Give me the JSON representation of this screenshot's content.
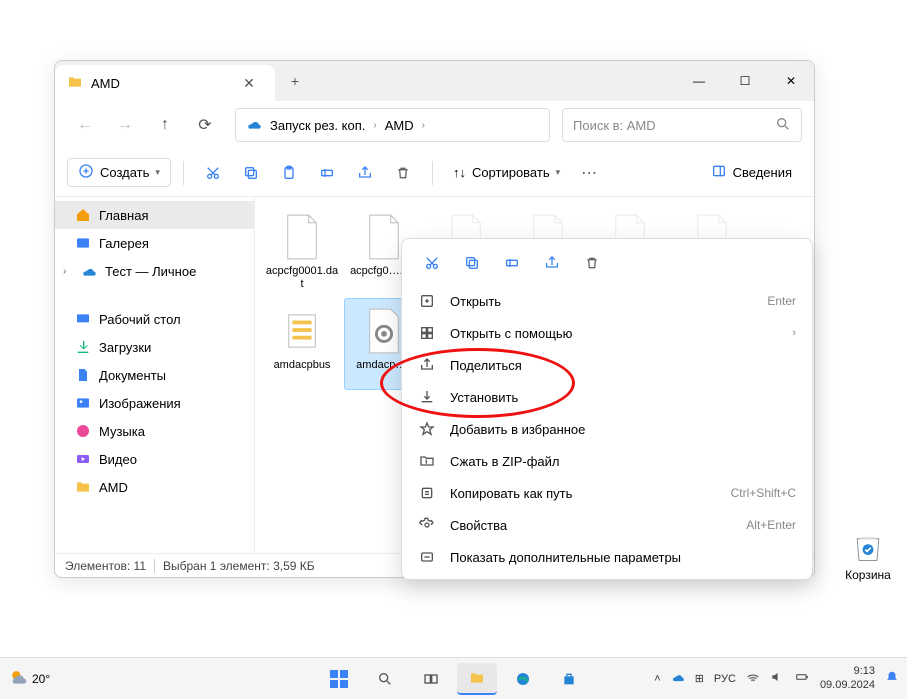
{
  "window": {
    "tab_title": "AMD",
    "breadcrumb": {
      "root": "Запуск рез. коп.",
      "folder": "AMD"
    },
    "search_placeholder": "Поиск в: AMD",
    "toolbar": {
      "create": "Создать",
      "sort": "Сортировать",
      "details": "Сведения"
    },
    "sidebar": {
      "home": "Главная",
      "gallery": "Галерея",
      "personal": "Тест — Личное",
      "desktop": "Рабочий стол",
      "downloads": "Загрузки",
      "documents": "Документы",
      "pictures": "Изображения",
      "music": "Музыка",
      "videos": "Видео",
      "amd": "AMD"
    },
    "files": [
      {
        "name": "acpcfg0001.dat",
        "type": "dat"
      },
      {
        "name": "acpcfg0….dat",
        "type": "dat"
      },
      {
        "name": "",
        "type": "dat"
      },
      {
        "name": "",
        "type": "dat"
      },
      {
        "name": "",
        "type": "dat"
      },
      {
        "name": "",
        "type": "dat"
      },
      {
        "name": "amdacpbus",
        "type": "inf-b"
      },
      {
        "name": "amdacp…s",
        "type": "inf",
        "selected": true
      }
    ],
    "status": {
      "count": "Элементов: 11",
      "selected": "Выбран 1 элемент: 3,59 КБ"
    }
  },
  "context_menu": {
    "open": {
      "label": "Открыть",
      "shortcut": "Enter"
    },
    "open_with": "Открыть с помощью",
    "share": "Поделиться",
    "install": "Установить",
    "favorite": "Добавить в избранное",
    "zip": "Сжать в ZIP-файл",
    "copy_path": {
      "label": "Копировать как путь",
      "shortcut": "Ctrl+Shift+C"
    },
    "properties": {
      "label": "Свойства",
      "shortcut": "Alt+Enter"
    },
    "more": "Показать дополнительные параметры"
  },
  "desktop": {
    "trash": "Корзина"
  },
  "taskbar": {
    "weather": "20°",
    "lang": "РУС",
    "time": "9:13",
    "date": "09.09.2024"
  }
}
